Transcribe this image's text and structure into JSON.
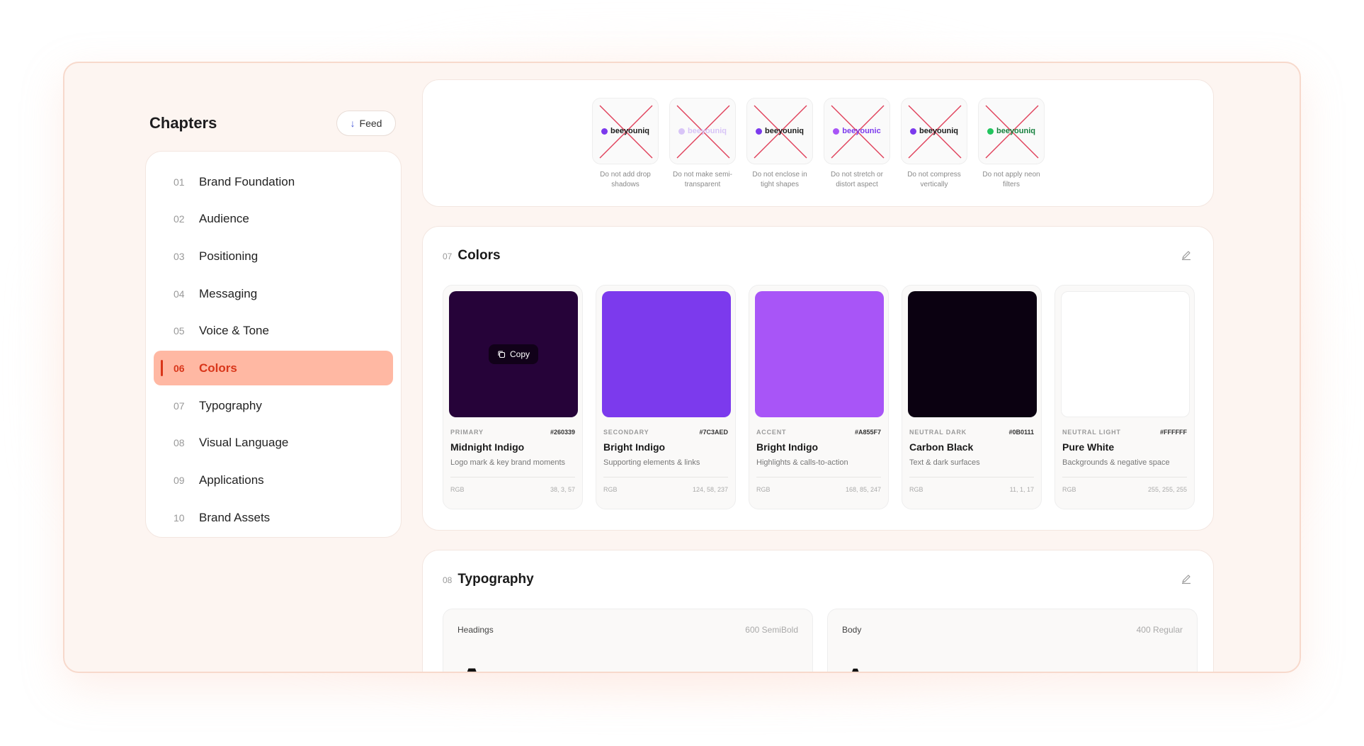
{
  "sidebar": {
    "title": "Chapters",
    "feed_label": "Feed",
    "items": [
      {
        "num": "01",
        "label": "Brand Foundation"
      },
      {
        "num": "02",
        "label": "Audience"
      },
      {
        "num": "03",
        "label": "Positioning"
      },
      {
        "num": "04",
        "label": "Messaging"
      },
      {
        "num": "05",
        "label": "Voice & Tone"
      },
      {
        "num": "06",
        "label": "Colors"
      },
      {
        "num": "07",
        "label": "Typography"
      },
      {
        "num": "08",
        "label": "Visual Language"
      },
      {
        "num": "09",
        "label": "Applications"
      },
      {
        "num": "10",
        "label": "Brand Assets"
      }
    ],
    "active_index": 5
  },
  "logo_misuse": [
    {
      "logo_text": "beeyouniq",
      "dot_color": "#7C3AED",
      "text_color": "#1a1a1a",
      "caption": "Do not add drop shadows"
    },
    {
      "logo_text": "beeyouniq",
      "dot_color": "#D8C4F7",
      "text_color": "#D8C4F7",
      "caption": "Do not make semi-transparent"
    },
    {
      "logo_text": "beeyouniq",
      "dot_color": "#7C3AED",
      "text_color": "#1a1a1a",
      "caption": "Do not enclose in tight shapes"
    },
    {
      "logo_text": "beeyounic",
      "dot_color": "#A855F7",
      "text_color": "#7C3AED",
      "caption": "Do not stretch or distort aspect"
    },
    {
      "logo_text": "beeyouniq",
      "dot_color": "#7C3AED",
      "text_color": "#1a1a1a",
      "caption": "Do not compress vertically"
    },
    {
      "logo_text": "beeyouniq",
      "dot_color": "#22C55E",
      "text_color": "#15803D",
      "caption": "Do not apply neon filters"
    }
  ],
  "colors_section": {
    "num": "07",
    "title": "Colors",
    "copy_label": "Copy",
    "swatches": [
      {
        "role": "PRIMARY",
        "hex": "#260339",
        "name": "Midnight Indigo",
        "usage": "Logo mark & key brand moments",
        "rgb_label": "RGB",
        "rgb": "38, 3, 57"
      },
      {
        "role": "SECONDARY",
        "hex": "#7C3AED",
        "name": "Bright Indigo",
        "usage": "Supporting elements & links",
        "rgb_label": "RGB",
        "rgb": "124, 58, 237"
      },
      {
        "role": "ACCENT",
        "hex": "#A855F7",
        "name": "Bright Indigo",
        "usage": "Highlights & calls-to-action",
        "rgb_label": "RGB",
        "rgb": "168, 85, 247"
      },
      {
        "role": "NEUTRAL DARK",
        "hex": "#0B0111",
        "name": "Carbon Black",
        "usage": "Text & dark surfaces",
        "rgb_label": "RGB",
        "rgb": "11, 1, 17"
      },
      {
        "role": "NEUTRAL LIGHT",
        "hex": "#FFFFFF",
        "name": "Pure White",
        "usage": "Backgrounds & negative space",
        "rgb_label": "RGB",
        "rgb": "255, 255, 255"
      }
    ]
  },
  "typography_section": {
    "num": "08",
    "title": "Typography",
    "cards": [
      {
        "kind": "Headings",
        "weight": "600 SemiBold",
        "sample": "Aa"
      },
      {
        "kind": "Body",
        "weight": "400 Regular",
        "sample": "Aa"
      }
    ]
  }
}
